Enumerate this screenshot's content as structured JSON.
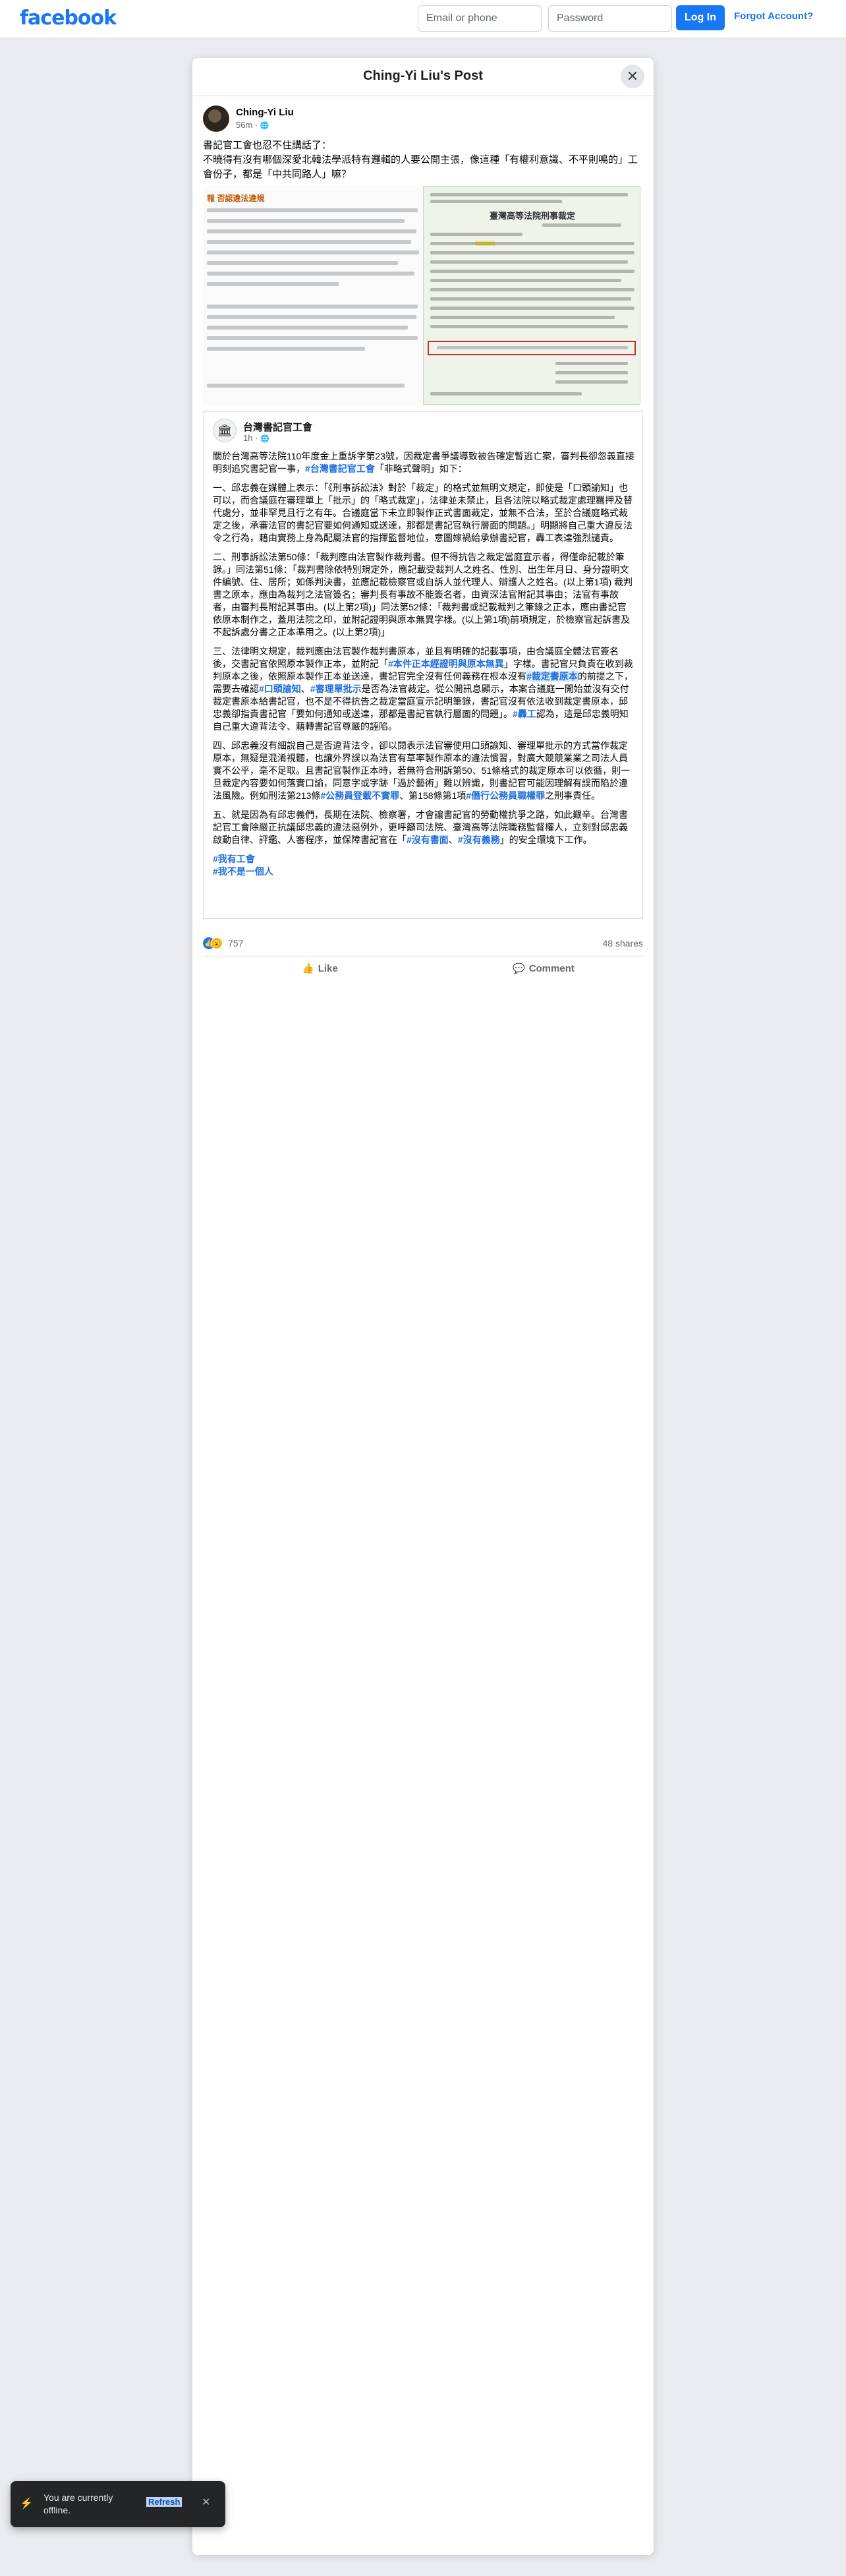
{
  "header": {
    "logo": "facebook",
    "email_placeholder": "Email or phone",
    "password_placeholder": "Password",
    "login_label": "Log In",
    "forgot_label": "Forgot Account?"
  },
  "post": {
    "title": "Ching-Yi Liu's Post",
    "close_symbol": "✕",
    "author": "Ching-Yi Liu",
    "time": "56m · ",
    "globe": "🌐",
    "text_line1": "書記官工會也忍不住講話了：",
    "text_line2": "不曉得有沒有哪個深愛北韓法學派特有邏輯的人要公開主張，像這種「有權利意識、不平則鳴的」工會份子，都是「中共同路人」嘛？"
  },
  "image": {
    "left_heading": "報 否認違法違規",
    "right_title": "臺灣高等法院刑事裁定"
  },
  "shared": {
    "avatar_symbol": "🏛",
    "name": "台灣書記官工會",
    "time": "1h · ",
    "globe": "🌐",
    "intro_a": "關於台灣高等法院110年度金上重訴字第23號，因裁定書爭議導致被告確定暫逃亡案，審判長卻忽義直接明刻追究書記官一事，",
    "intro_tag": "#台灣書記官工會",
    "intro_b": "「非略式聲明」如下：",
    "p1": "一、邱忠義在媒體上表示：「《刑事訴訟法》對於「裁定」的格式並無明文規定，即使是「口頭諭知」也可以，而合議庭在審理單上「批示」的「略式裁定」，法律並未禁止，且各法院以略式裁定處理羈押及替代處分，並非罕見且行之有年。合議庭當下未立即製作正式書面裁定，並無不合法，至於合議庭略式裁定之後，承審法官的書記官要如何通知或送達，那都是書記官執行層面的問題。」明顯將自己重大違反法令之行為，藉由實務上身為配屬法官的指揮監督地位，意圖嫁禍給承辦書記官，轟工表達強烈譴責。",
    "p2": "二、刑事訴訟法第50條：「裁判應由法官製作裁判書。但不得抗告之裁定當庭宣示者，得僅命記載於筆錄。」同法第51條：「裁判書除依特別規定外，應記載受裁判人之姓名、性別、出生年月日、身分證明文件編號、住、居所；如係判決書，並應記載檢察官或自訴人並代理人、辯護人之姓名。(以上第1項) 裁判書之原本，應由為裁判之法官簽名；審判長有事故不能簽名者，由資深法官附記其事由；法官有事故者，由審判長附記其事由。(以上第2項)」同法第52條：「裁判書或記載裁判之筆錄之正本，應由書記官依原本制作之，蓋用法院之印，並附記證明與原本無異字樣。(以上第1項)前項規定，於檢察官起訴書及不起訴處分書之正本準用之。(以上第2項)」",
    "p3a": "三、法律明文規定，裁判應由法官製作裁判書原本，並且有明確的記載事項，由合議庭全體法官簽名後，交書記官依照原本製作正本，並附記「",
    "p3_tag1": "#本件正本經證明與原本無異",
    "p3b": "」字樣。書記官只負責在收到裁判原本之後，依照原本製作正本並送達，書記官完全沒有任何義務在根本沒有",
    "p3_tag2": "#裁定書原本",
    "p3c": "的前提之下，需要去確認",
    "p3_tag3": "#口頭諭知",
    "p3d": "、",
    "p3_tag4": "#審理單批示",
    "p3e": "是否為法官裁定。從公開訊息顯示，本案合議庭一開始並沒有交付裁定書原本給書記官，也不是不得抗告之裁定當庭宣示記明筆錄，書記官沒有依法收到裁定書原本，邱忠義卻指責書記官「要如何通知或送達，那都是書記官執行層面的問題」。",
    "p3_tag5": "#轟工",
    "p3f": "認為，這是邱忠義明知自己重大違背法令、藉轉書記官尊嚴的誣陷。",
    "p4a": "四、邱忠義沒有細說自己是否違背法令，卻以閱表示法官審使用口頭諭知、審理單批示的方式當作裁定原本，無疑是混淆視聽，也讓外界誤以為法官有草率製作原本的違法慣習，對廣大競競業業之司法人員實不公平，毫不足取。且書記官製作正本時，若無符合刑訴第50、51條格式的裁定原本可以依循，則一旦裁定內容要如何落實口諭，同意字或字跡「過於藝術」難以辨識，則書記官可能因理解有誤而陷於違法風險。例如刑法第213條",
    "p4_tag1": "#公務員登載不實罪",
    "p4b": "、第158條第1項",
    "p4_tag2": "#僭行公務員職權罪",
    "p4c": "之刑事責任。",
    "p5a": "五、就是因為有邱忠義們，長期在法院、檢察署，才會讓書記官的勞動權抗爭之路，如此艱辛。台灣書記官工會除嚴正抗議邱忠義的違法惡例外，更呼籲司法院、臺灣高等法院職務監督權人，立刻對邱忠義啟動自律、評鑑、人審程序，並保障書記官在「",
    "p5_tag1": "#沒有書面",
    "p5_sep": "、",
    "p5_tag2": "#沒有義務",
    "p5b": "」的安全環境下工作。",
    "footer_tag1": "#我有工會",
    "footer_tag2": "#我不是一個人"
  },
  "stats": {
    "reaction_count": "757",
    "shares": "48 shares",
    "like_label": "Like",
    "comment_label": "Comment"
  },
  "toast": {
    "text": "You are currently offline.",
    "refresh_label": "Refresh",
    "close_symbol": "✕"
  },
  "colors": {
    "brand": "#1877f2",
    "tag": "#216fdb",
    "highlight_red": "#d12a2a"
  }
}
